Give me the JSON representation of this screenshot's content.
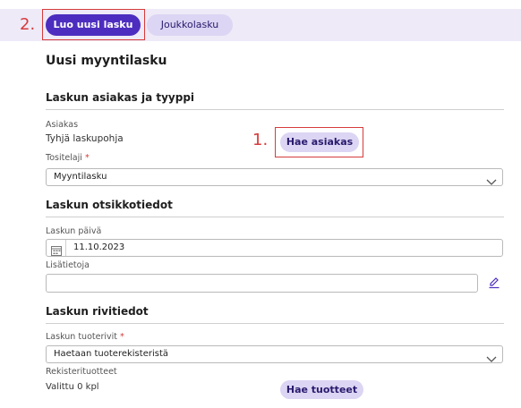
{
  "annotations": {
    "marker_1": "1.",
    "marker_2": "2."
  },
  "tabs": {
    "new_invoice": "Luo uusi lasku",
    "bulk_invoice": "Joukkolasku"
  },
  "page": {
    "title": "Uusi myyntilasku"
  },
  "customer_section": {
    "title": "Laskun asiakas ja tyyppi",
    "customer_label": "Asiakas",
    "customer_value": "Tyhjä laskupohja",
    "search_button": "Hae asiakas",
    "doc_type_label": "Tositelaji",
    "required_mark": "*",
    "doc_type_value": "Myyntilasku"
  },
  "header_section": {
    "title": "Laskun otsikkotiedot",
    "date_label": "Laskun päivä",
    "date_value": "11.10.2023",
    "info_label": "Lisätietoja",
    "info_value": ""
  },
  "rows_section": {
    "title": "Laskun rivitiedot",
    "product_rows_label": "Laskun tuoterivit",
    "required_mark": "*",
    "product_rows_value": "Haetaan tuoterekisteristä",
    "registry_label": "Rekisterituotteet",
    "selected_value": "Valittu 0 kpl",
    "fetch_button": "Hae tuotteet"
  },
  "colors": {
    "primary": "#4d2dbf",
    "soft": "#dcd5f3",
    "highlight": "#d63b3b",
    "topbar": "#eeeaf8"
  }
}
